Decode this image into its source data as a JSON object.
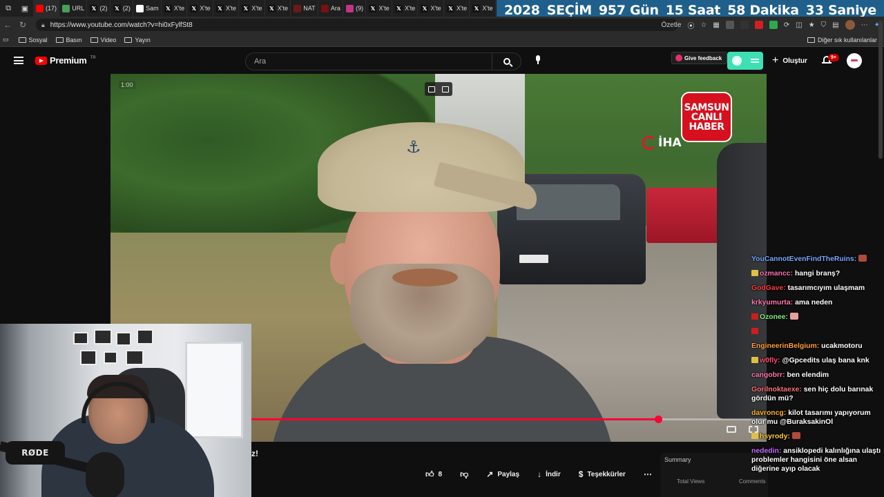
{
  "browser": {
    "tabs": [
      {
        "label": "(17)",
        "fav": "youtube-favicon",
        "color": "#ff0000"
      },
      {
        "label": "URL",
        "fav": "robot-favicon",
        "color": "#46a05a"
      },
      {
        "label": "(2)",
        "fav": "x-favicon",
        "color": "#111111"
      },
      {
        "label": "(2)",
        "fav": "x-favicon",
        "color": "#111111"
      },
      {
        "label": "Sam",
        "fav": "google-favicon",
        "color": "#ffffff"
      },
      {
        "label": "X'te",
        "fav": "x-favicon",
        "color": "#111111"
      },
      {
        "label": "X'te",
        "fav": "x-favicon",
        "color": "#111111"
      },
      {
        "label": "X'te",
        "fav": "x-favicon",
        "color": "#111111"
      },
      {
        "label": "X'te",
        "fav": "x-favicon",
        "color": "#111111"
      },
      {
        "label": "X'te",
        "fav": "x-favicon",
        "color": "#111111"
      },
      {
        "label": "NAT",
        "fav": "nat-favicon",
        "color": "#6b1a1a"
      },
      {
        "label": "Ara",
        "fav": "search-favicon",
        "color": "#7a1010"
      },
      {
        "label": "(9)",
        "fav": "instagram-favicon",
        "color": "#c13584"
      },
      {
        "label": "X'te",
        "fav": "x-favicon",
        "color": "#111111"
      },
      {
        "label": "X'te",
        "fav": "x-favicon",
        "color": "#111111"
      },
      {
        "label": "X'te",
        "fav": "x-favicon",
        "color": "#111111"
      },
      {
        "label": "X'te",
        "fav": "x-favicon",
        "color": "#111111"
      },
      {
        "label": "X'te",
        "fav": "x-favicon",
        "color": "#111111"
      }
    ],
    "url": "https://www.youtube.com/watch?v=hi0xFylfSt8",
    "summarize_label": "Özetle",
    "bookmarks": [
      "Sosyal",
      "Basın",
      "Video",
      "Yayın"
    ],
    "other_bookmarks": "Diğer sık kullanılanlar"
  },
  "countdown": {
    "year": "2028",
    "label": "SEÇİM",
    "days": "957 Gün",
    "hours": "15 Saat",
    "minutes": "58 Dakika",
    "seconds": "33 Saniye"
  },
  "youtube": {
    "brand": "Premium",
    "region": "TR",
    "search_placeholder": "Ara",
    "feedback_label": "Give feedback",
    "create_label": "Oluştur",
    "notifications": "9+"
  },
  "video": {
    "time": "1:00",
    "progress": 0.79,
    "channel_logo": [
      "SAMSUN",
      "CANLI",
      "HABER"
    ],
    "agency": "İHA",
    "webcam_mic_brand": "RØDE",
    "title_fragment": "z!",
    "likes": "8",
    "share_label": "Paylaş",
    "download_label": "İndir",
    "thanks_label": "Teşekkürler",
    "summary_title": "Summary",
    "summary_col1": "Total Views",
    "summary_col2": "Comments"
  },
  "chat": [
    {
      "user": "YouCannotEvenFindTheRuins:",
      "color": "#78a7ff",
      "text": "",
      "badge": "",
      "emote": "#b04a3a"
    },
    {
      "user": "ozmancc:",
      "color": "#ff6fb0",
      "text": "hangi branş?",
      "badge": "#e0c040",
      "emote": ""
    },
    {
      "user": "GodGave:",
      "color": "#ff3b3b",
      "text": "tasarımcıyım ulaşmam",
      "badge": "",
      "emote": ""
    },
    {
      "user": "krkyumurta:",
      "color": "#ff77aa",
      "text": "ama neden",
      "badge": "",
      "emote": ""
    },
    {
      "user": "Ozonee:",
      "color": "#7ef07e",
      "text": "",
      "badge": "#d01c1c",
      "emote": "#e8a0a0"
    },
    {
      "user": "",
      "color": "#ffffff",
      "text": "",
      "badge": "#d01c1c",
      "emote": ""
    },
    {
      "user": "EngineerinBelgium:",
      "color": "#ff9e3b",
      "text": "ucakmotoru",
      "badge": "",
      "emote": ""
    },
    {
      "user": "w0fly:",
      "color": "#ff4a6a",
      "text": "@Gpcedits ulaş bana knk",
      "badge": "#e0c040",
      "emote": ""
    },
    {
      "user": "cangobrr:",
      "color": "#ff77aa",
      "text": "ben elendim",
      "badge": "",
      "emote": ""
    },
    {
      "user": "Gorilnoktaexe:",
      "color": "#ff6f6f",
      "text": "sen hiç dolu barınak gördün mü?",
      "badge": "",
      "emote": ""
    },
    {
      "user": "davroncg:",
      "color": "#ffb02e",
      "text": "kilot tasarımı yapıyorum olur mu @BuraksakinOl",
      "badge": "",
      "emote": ""
    },
    {
      "user": "hsyrody:",
      "color": "#ffcf3b",
      "text": "",
      "badge": "#e0c040",
      "emote": "#b04a3a"
    },
    {
      "user": "nededin:",
      "color": "#c46bff",
      "text": "ansiklopedi kalınlığına ulaştı problemler hangisini öne alsan diğerine ayıp olacak",
      "badge": "",
      "emote": ""
    }
  ]
}
